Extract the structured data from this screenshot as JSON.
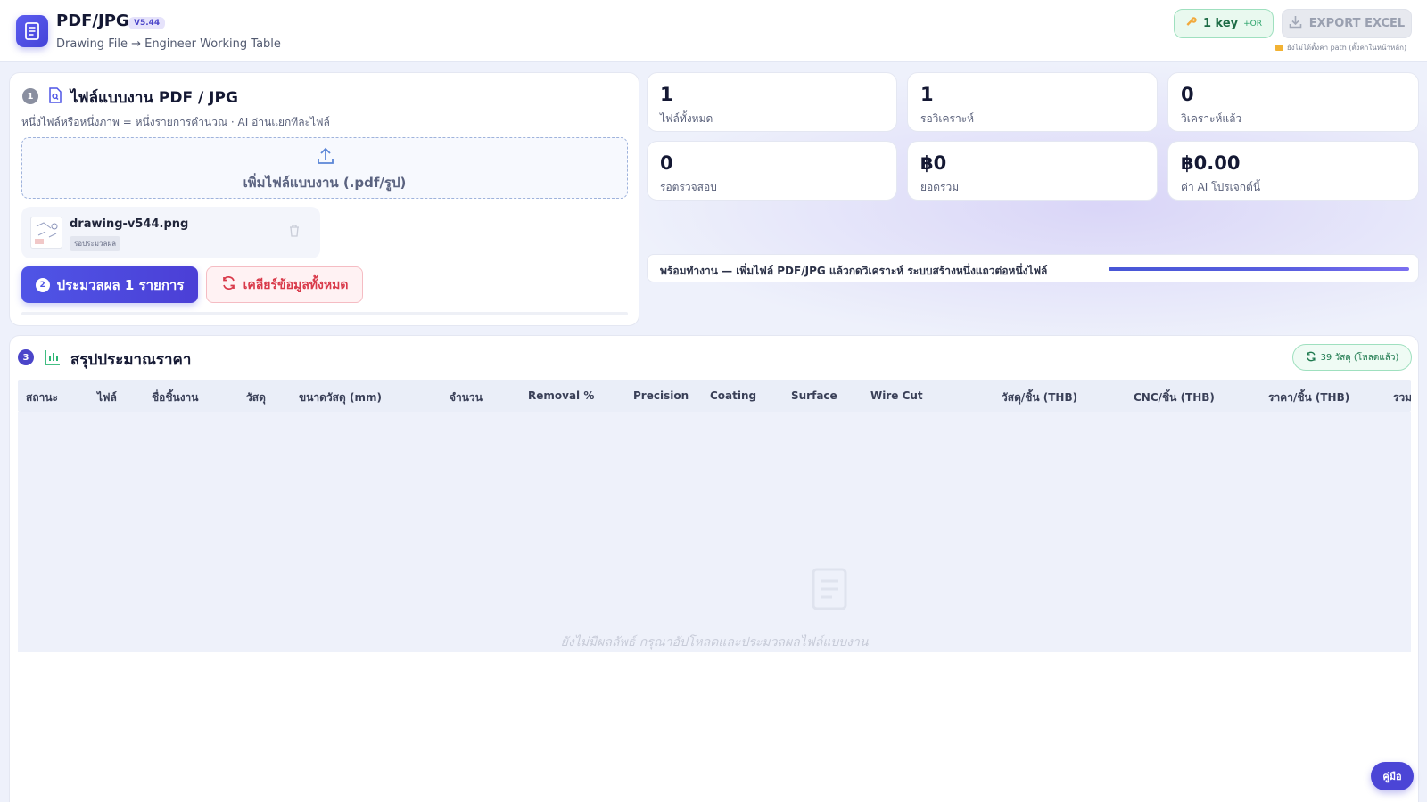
{
  "header": {
    "app_title": "PDF/JPG",
    "version": "V5.44",
    "subtitle": "Drawing File → Engineer Working Table",
    "key_label": "1 key",
    "key_or": "+OR",
    "export_label": "EXPORT EXCEL",
    "path_note": "ยังไม่ได้ตั้งค่า path (ตั้งค่าในหน้าหลัก)"
  },
  "upload": {
    "step": "1",
    "title": "ไฟล์แบบงาน PDF / JPG",
    "description": "หนึ่งไฟล์หรือหนึ่งภาพ = หนึ่งรายการคำนวณ · AI อ่านแยกทีละไฟล์",
    "dropzone_label": "เพิ่มไฟล์แบบงาน (.pdf/รูป)",
    "file": {
      "name": "drawing-v544.png",
      "status": "รอประมวลผล"
    },
    "process_step": "2",
    "process_label": "ประมวลผล 1 รายการ",
    "clear_label": "เคลียร์ข้อมูลทั้งหมด"
  },
  "stats": [
    {
      "value": "1",
      "label": "ไฟล์ทั้งหมด"
    },
    {
      "value": "1",
      "label": "รอวิเคราะห์"
    },
    {
      "value": "0",
      "label": "วิเคราะห์แล้ว"
    },
    {
      "value": "0",
      "label": "รอตรวจสอบ"
    },
    {
      "value": "฿0",
      "label": "ยอดรวม"
    },
    {
      "value": "฿0.00",
      "label": "ค่า AI โปรเจกต์นี้"
    }
  ],
  "status": {
    "text": "พร้อมทำงาน — เพิ่มไฟล์ PDF/JPG แล้วกดวิเคราะห์ ระบบสร้างหนึ่งแถวต่อหนึ่งไฟล์"
  },
  "summary": {
    "step": "3",
    "title": "สรุปประมาณราคา",
    "materials_badge": "39 วัสดุ (โหลดแล้ว)",
    "columns": [
      "สถานะ",
      "ไฟล์",
      "ชื่อชิ้นงาน",
      "วัสดุ",
      "ขนาดวัสดุ (mm)",
      "จำนวน",
      "Removal %",
      "Precision",
      "Coating",
      "Surface",
      "Wire Cut",
      "วัสดุ/ชิ้น (THB)",
      "CNC/ชิ้น (THB)",
      "ราคา/ชิ้น (THB)",
      "รวม"
    ],
    "empty_text": "ยังไม่มีผลลัพธ์ กรุณาอัปโหลดและประมวลผลไฟล์แบบงาน"
  },
  "help_label": "คู่มือ"
}
